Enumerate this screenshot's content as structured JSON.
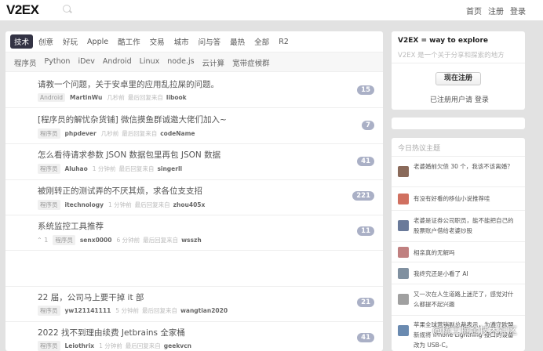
{
  "header": {
    "logo": "V2EX",
    "nav": [
      "首页",
      "注册",
      "登录"
    ]
  },
  "tabs": [
    {
      "label": "技术",
      "active": true
    },
    {
      "label": "创意"
    },
    {
      "label": "好玩"
    },
    {
      "label": "Apple"
    },
    {
      "label": "酷工作"
    },
    {
      "label": "交易"
    },
    {
      "label": "城市"
    },
    {
      "label": "问与答"
    },
    {
      "label": "最热"
    },
    {
      "label": "全部"
    },
    {
      "label": "R2"
    }
  ],
  "subtabs": [
    "程序员",
    "Python",
    "iDev",
    "Android",
    "Linux",
    "node.js",
    "云计算",
    "宽带症候群"
  ],
  "topics": [
    {
      "title": "请教一个问题，关于安卓里的应用乱拉屎的问题。",
      "node": "Android",
      "author": "MartinWu",
      "time": "几秒前",
      "last": "最后回复来自",
      "last_user": "libook",
      "count": "15"
    },
    {
      "title": "[程序员的解忧杂货铺] 微信摸鱼群诚邀大佬们加入~",
      "node": "程序员",
      "author": "phpdever",
      "time": "几秒前",
      "last": "最后回复来自",
      "last_user": "codeName",
      "count": "7"
    },
    {
      "title": "怎么看待请求参数 JSON 数据包里再包 JSON 数据",
      "node": "程序员",
      "author": "Aluhao",
      "time": "1 分钟前",
      "last": "最后回复来自",
      "last_user": "singerll",
      "count": "41"
    },
    {
      "title": "被刚转正的测试弄的不厌其烦，求各位支支招",
      "node": "程序员",
      "author": "itechnology",
      "time": "1 分钟前",
      "last": "最后回复来自",
      "last_user": "zhou405x",
      "count": "221"
    },
    {
      "title": "系统监控工具推荐",
      "node": "程序员",
      "author": "senx0000",
      "time": "6 分钟前",
      "last": "最后回复来自",
      "last_user": "wsszh",
      "count": "11",
      "votes": "1"
    },
    {
      "title": "22 届，公司马上要干掉 it 部",
      "node": "程序员",
      "author": "yw121141111",
      "time": "5 分钟前",
      "last": "最后回复来自",
      "last_user": "wangtian2020",
      "count": "21"
    },
    {
      "title": "2022 找不到理由续费 Jetbrains 全家桶",
      "node": "程序员",
      "author": "Leiothrix",
      "time": "1 分钟前",
      "last": "最后回复来自",
      "last_user": "geekvcn",
      "count": "41"
    }
  ],
  "sidebar": {
    "intro_title": "V2EX = way to explore",
    "intro_desc": "V2EX 是一个关于分享和探索的地方",
    "signup": "现在注册",
    "login_prefix": "已注册用户请",
    "login": "登录",
    "hot_header": "今日热议主题",
    "hot": [
      {
        "text": "老婆婚前欠债 30 个，我该不该离婚？",
        "color": "#8a6a5a"
      },
      {
        "text": "有没有好看的移仙小说推荐哇",
        "color": "#d07060"
      },
      {
        "text": "老婆是证券公司职员，能不能把自己的股票账户借给老婆炒股",
        "color": "#6a7a9a"
      },
      {
        "text": "相亲真的无解吗",
        "color": "#c08080"
      },
      {
        "text": "我终究还是小看了 AI",
        "color": "#8090a0"
      },
      {
        "text": "又一次在人生道路上迷茫了，感觉对什么都提不起兴趣",
        "color": "#a0a0a0"
      },
      {
        "text": "苹果全球营销副总裁表示，为遵守欧盟新规将 iPhone Lightning 接口的设备改为 USB-C。",
        "color": "#6a8ab0"
      }
    ]
  },
  "watermark": "@稀土掘金技术社区"
}
